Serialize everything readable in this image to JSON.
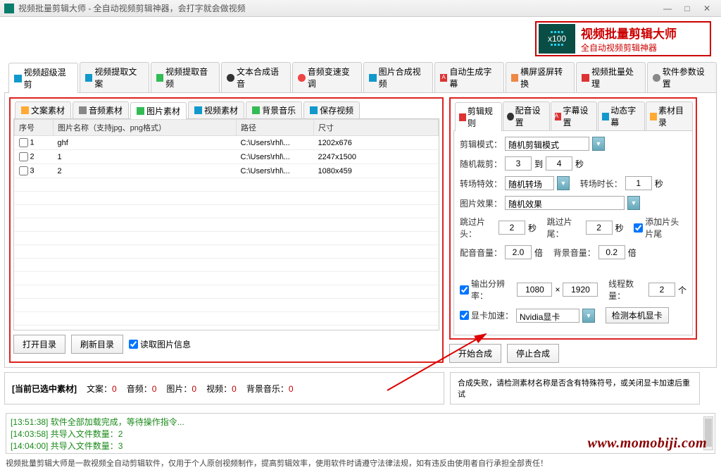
{
  "title": "视频批量剪辑大师 - 全自动视频剪辑神器，会打字就会做视频",
  "banner": {
    "badge": "x100",
    "title": "视频批量剪辑大师",
    "subtitle": "全自动视频剪辑神器"
  },
  "mainTabs": [
    "视频超级混剪",
    "视频提取文案",
    "视频提取音频",
    "文本合成语音",
    "音频变速变调",
    "图片合成视频",
    "自动生成字幕",
    "横屏竖屏转换",
    "视频批量处理",
    "软件参数设置"
  ],
  "subTabs": [
    "文案素材",
    "音频素材",
    "图片素材",
    "视频素材",
    "背景音乐",
    "保存视频"
  ],
  "tableHeaders": {
    "seq": "序号",
    "name": "图片名称（支持jpg、png格式）",
    "path": "路径",
    "size": "尺寸"
  },
  "rows": [
    {
      "seq": "1",
      "name": "ghf",
      "path": "C:\\Users\\rhl\\...",
      "size": "1202x676"
    },
    {
      "seq": "2",
      "name": "1",
      "path": "C:\\Users\\rhl\\...",
      "size": "2247x1500"
    },
    {
      "seq": "3",
      "name": "2",
      "path": "C:\\Users\\rhl\\...",
      "size": "1080x459"
    }
  ],
  "btns": {
    "open": "打开目录",
    "refresh": "刷新目录",
    "readinfo": "读取图片信息"
  },
  "rightTabs": [
    "剪辑规则",
    "配音设置",
    "字幕设置",
    "动态字幕",
    "素材目录"
  ],
  "form": {
    "editModeLabel": "剪辑模式：",
    "editMode": "随机剪辑模式",
    "randCutLabel": "随机裁剪：",
    "randFrom": "3",
    "to": "到",
    "randTo": "4",
    "sec": "秒",
    "transLabel": "转场特效：",
    "transVal": "随机转场",
    "transDurLabel": "转场时长：",
    "transDur": "1",
    "imgFxLabel": "图片效果：",
    "imgFx": "随机效果",
    "skipHeadLabel": "跳过片头：",
    "skipHead": "2",
    "skipTailLabel": "跳过片尾：",
    "skipTail": "2",
    "addHT": "添加片头片尾",
    "dubVolLabel": "配音音量：",
    "dubVol": "2.0",
    "bei": "倍",
    "bgVolLabel": "背景音量：",
    "bgVol": "0.2",
    "resLabel": "输出分辨率：",
    "resW": "1080",
    "x": "×",
    "resH": "1920",
    "threadLabel": "线程数量：",
    "threads": "2",
    "ge": "个",
    "gpuLabel": "显卡加速：",
    "gpu": "Nvidia显卡",
    "detect": "检测本机显卡"
  },
  "actions": {
    "start": "开始合成",
    "stop": "停止合成"
  },
  "status": {
    "selLabel": "[当前已选中素材]",
    "textL": "文案：",
    "textV": "0",
    "audioL": "音频：",
    "audioV": "0",
    "imgL": "图片：",
    "imgV": "0",
    "vidL": "视频：",
    "vidV": "0",
    "bgmL": "背景音乐：",
    "bgmV": "0",
    "rightMsg": "合成失败，请检测素材名称是否含有特殊符号，或关闭显卡加速后重试"
  },
  "logs": [
    "[13:51:38] 软件全部加载完成，等待操作指令...",
    "[14:03:58] 共导入文件数量：2",
    "[14:04:00] 共导入文件数量：3"
  ],
  "watermark": "www.momobiji.com",
  "footer": "视频批量剪辑大师是一款视频全自动剪辑软件，仅用于个人原创视频制作，提高剪辑效率，使用软件时请遵守法律法规，如有违反由使用者自行承担全部责任！"
}
